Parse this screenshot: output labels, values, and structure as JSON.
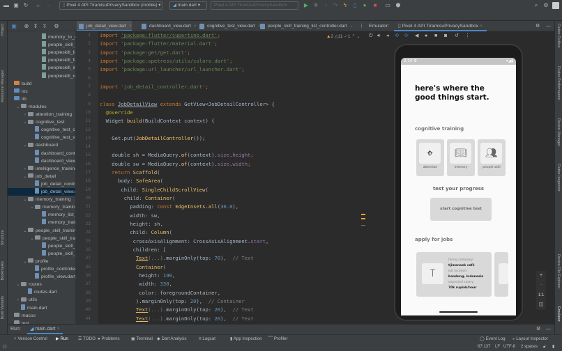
{
  "toolbar": {
    "device_selector": "Pixel 4 API TiramisuPrivacySandbox (mobile)",
    "run_config": "main.dart",
    "target_device": "Pixel 4 API TiramisuPrivacySandbox",
    "icons": [
      "folder-open-icon",
      "save-icon",
      "sync-icon",
      "back-icon",
      "forward-icon",
      "run-icon",
      "debug-icon",
      "profile-icon",
      "attach-icon",
      "hot-reload-icon",
      "device-icon",
      "apply-changes-icon",
      "stop-icon",
      "device-manager-icon",
      "sdk-manager-icon",
      "search-icon",
      "settings-icon",
      "avatar-icon"
    ]
  },
  "left_strip": [
    "Project",
    "Resource Manager",
    "Structure",
    "Bookmarks",
    "Build Variants"
  ],
  "project_tree": [
    {
      "name": "memory_to_do_list_t",
      "depth": 4,
      "type": "png"
    },
    {
      "name": "people_skill_icon.png",
      "depth": 4,
      "type": "png"
    },
    {
      "name": "peopleskill_face_fact",
      "depth": 4,
      "type": "png"
    },
    {
      "name": "peopleskill_face_to_f",
      "depth": 4,
      "type": "png"
    },
    {
      "name": "peopleskill_in_the_k",
      "depth": 4,
      "type": "png"
    },
    {
      "name": "peopleskill_recogniti",
      "depth": 4,
      "type": "png"
    },
    {
      "name": "build",
      "depth": 0,
      "type": "folder-orange"
    },
    {
      "name": "ios",
      "depth": 0,
      "type": "folder-blue"
    },
    {
      "name": "lib",
      "depth": 0,
      "type": "folder-blue"
    },
    {
      "name": "modules",
      "depth": 1,
      "type": "folder",
      "chev": "open"
    },
    {
      "name": "attention_training",
      "depth": 2,
      "type": "folder",
      "chev": "closed"
    },
    {
      "name": "cognitive_test",
      "depth": 2,
      "type": "folder",
      "chev": "open"
    },
    {
      "name": "cognitive_test_co",
      "depth": 3,
      "type": "dart"
    },
    {
      "name": "cognitive_test_vie",
      "depth": 3,
      "type": "dart"
    },
    {
      "name": "dashboard",
      "depth": 2,
      "type": "folder",
      "chev": "open"
    },
    {
      "name": "dashboard_contro",
      "depth": 3,
      "type": "dart"
    },
    {
      "name": "dashboard_view.d",
      "depth": 3,
      "type": "dart"
    },
    {
      "name": "intelligence_training",
      "depth": 2,
      "type": "folder",
      "chev": "closed"
    },
    {
      "name": "job_detail",
      "depth": 2,
      "type": "folder",
      "chev": "open"
    },
    {
      "name": "job_detail_control",
      "depth": 3,
      "type": "dart"
    },
    {
      "name": "job_detail_view.da",
      "depth": 3,
      "type": "dart",
      "selected": true
    },
    {
      "name": "memory_training",
      "depth": 2,
      "type": "folder",
      "chev": "open"
    },
    {
      "name": "memory_training_",
      "depth": 3,
      "type": "folder",
      "chev": "open"
    },
    {
      "name": "memory_list_v",
      "depth": 4,
      "type": "dart"
    },
    {
      "name": "memory_traini",
      "depth": 4,
      "type": "dart"
    },
    {
      "name": "people_skill_training",
      "depth": 2,
      "type": "folder",
      "chev": "open"
    },
    {
      "name": "people_skill_trai",
      "depth": 3,
      "type": "folder",
      "chev": "open"
    },
    {
      "name": "people_skill_tr",
      "depth": 4,
      "type": "dart"
    },
    {
      "name": "people_skill_tr",
      "depth": 4,
      "type": "dart"
    },
    {
      "name": "profile",
      "depth": 2,
      "type": "folder",
      "chev": "open"
    },
    {
      "name": "profile_controller.d",
      "depth": 3,
      "type": "dart"
    },
    {
      "name": "profile_view.dart",
      "depth": 3,
      "type": "dart"
    },
    {
      "name": "routes",
      "depth": 1,
      "type": "folder",
      "chev": "open"
    },
    {
      "name": "routes.dart",
      "depth": 2,
      "type": "dart"
    },
    {
      "name": "utils",
      "depth": 1,
      "type": "folder",
      "chev": "closed"
    },
    {
      "name": "main.dart",
      "depth": 1,
      "type": "dart"
    },
    {
      "name": "macos",
      "depth": 0,
      "type": "folder"
    },
    {
      "name": "test",
      "depth": 0,
      "type": "folder"
    }
  ],
  "editor_tabs": [
    {
      "label": "job_detail_view.dart",
      "active": true
    },
    {
      "label": "dashboard_view.dart"
    },
    {
      "label": "cognitive_test_view.dart"
    },
    {
      "label": "people_skill_training_list_controller.dart"
    }
  ],
  "inspections": {
    "warnings": "2",
    "weak_warnings": "11",
    "typos": "1"
  },
  "code": [
    {
      "n": "1",
      "t": [
        [
          "import",
          "kw"
        ],
        [
          " "
        ],
        [
          "'package:flutter/cupertino.dart'",
          "str u"
        ],
        [
          ";",
          "kw"
        ]
      ]
    },
    {
      "n": "2",
      "t": [
        [
          "import",
          "kw"
        ],
        [
          " "
        ],
        [
          "'package:flutter/material.dart'",
          "str"
        ],
        [
          ";",
          "kw"
        ]
      ]
    },
    {
      "n": "3",
      "t": [
        [
          "import",
          "kw"
        ],
        [
          " "
        ],
        [
          "'package:get/get.dart'",
          "str"
        ],
        [
          ";",
          "kw"
        ]
      ]
    },
    {
      "n": "4",
      "t": [
        [
          "import",
          "kw"
        ],
        [
          " "
        ],
        [
          "'package:spetress/utils/colors.dart'",
          "str"
        ],
        [
          ";",
          "kw"
        ]
      ]
    },
    {
      "n": "5",
      "t": [
        [
          "import",
          "kw"
        ],
        [
          " "
        ],
        [
          "'package:url_launcher/url_launcher.dart'",
          "str"
        ],
        [
          ";",
          "kw"
        ]
      ]
    },
    {
      "n": "6",
      "t": []
    },
    {
      "n": "7",
      "t": [
        [
          "import",
          "kw"
        ],
        [
          " "
        ],
        [
          "'job_detail_controller.dart'",
          "str"
        ],
        [
          ";",
          "kw"
        ]
      ]
    },
    {
      "n": "8",
      "t": []
    },
    {
      "n": "9",
      "t": [
        [
          "class",
          "kw"
        ],
        [
          " "
        ],
        [
          "JobDetailView",
          "u"
        ],
        [
          " "
        ],
        [
          "extends",
          "kw"
        ],
        [
          " GetView<JobDetailController> {"
        ]
      ]
    },
    {
      "n": "10",
      "t": [
        [
          "  "
        ],
        [
          "@override",
          "an"
        ]
      ]
    },
    {
      "n": "11",
      "t": [
        [
          "  Widget "
        ],
        [
          "build",
          "fn"
        ],
        [
          "(BuildContext context) {"
        ]
      ]
    },
    {
      "n": "12",
      "t": []
    },
    {
      "n": "13",
      "t": [
        [
          "    Get.put("
        ],
        [
          "JobDetailController",
          "fn"
        ],
        [
          "());"
        ]
      ]
    },
    {
      "n": "14",
      "t": []
    },
    {
      "n": "15",
      "t": [
        [
          "    double sh = MediaQuery."
        ],
        [
          "of",
          "fn"
        ],
        [
          "(context)."
        ],
        [
          "size",
          "prop"
        ],
        [
          "."
        ],
        [
          "height",
          "prop"
        ],
        [
          ";",
          "kw"
        ]
      ]
    },
    {
      "n": "16",
      "t": [
        [
          "    double sw = MediaQuery."
        ],
        [
          "of",
          "fn"
        ],
        [
          "(context)."
        ],
        [
          "size",
          "prop"
        ],
        [
          "."
        ],
        [
          "width",
          "prop"
        ],
        [
          ";",
          "kw"
        ]
      ]
    },
    {
      "n": "17",
      "t": [
        [
          "    "
        ],
        [
          "return",
          "kw"
        ],
        [
          " "
        ],
        [
          "Scaffold",
          "cls"
        ],
        [
          "("
        ]
      ]
    },
    {
      "n": "18",
      "t": [
        [
          "      body: "
        ],
        [
          "SafeArea",
          "cls"
        ],
        [
          "("
        ]
      ]
    },
    {
      "n": "19",
      "t": [
        [
          "       child: "
        ],
        [
          "SingleChildScrollView",
          "cls"
        ],
        [
          "("
        ]
      ]
    },
    {
      "n": "20",
      "t": [
        [
          "        child: "
        ],
        [
          "Container",
          "cls"
        ],
        [
          "("
        ]
      ]
    },
    {
      "n": "21",
      "t": [
        [
          "          padding: "
        ],
        [
          "const",
          "kw"
        ],
        [
          " "
        ],
        [
          "EdgeInsets.all",
          "cls"
        ],
        [
          "("
        ],
        [
          "30.0",
          "num"
        ],
        [
          "),"
        ]
      ]
    },
    {
      "n": "22",
      "t": [
        [
          "          width: sw,"
        ]
      ]
    },
    {
      "n": "23",
      "t": [
        [
          "          height: sh,"
        ]
      ]
    },
    {
      "n": "24",
      "t": [
        [
          "          child: "
        ],
        [
          "Column",
          "cls"
        ],
        [
          "("
        ]
      ]
    },
    {
      "n": "25",
      "t": [
        [
          "           crossAxisAlignment: CrossAxisAlignment."
        ],
        [
          "start",
          "prop"
        ],
        [
          ","
        ]
      ]
    },
    {
      "n": "26",
      "t": [
        [
          "           children: ["
        ]
      ]
    },
    {
      "n": "27",
      "t": [
        [
          "            "
        ],
        [
          "Text",
          "cls u"
        ],
        [
          "(...)",
          "cm"
        ],
        [
          ".marginOnly(top: "
        ],
        [
          "70",
          "num"
        ],
        [
          "),  "
        ],
        [
          "// Text",
          "cm"
        ]
      ]
    },
    {
      "n": "35",
      "t": [
        [
          "            "
        ],
        [
          "Container",
          "cls"
        ],
        [
          "("
        ]
      ]
    },
    {
      "n": "36",
      "t": [
        [
          "             height: "
        ],
        [
          "190",
          "num"
        ],
        [
          ","
        ]
      ]
    },
    {
      "n": "37",
      "t": [
        [
          "             width: "
        ],
        [
          "330",
          "num"
        ],
        [
          ","
        ]
      ]
    },
    {
      "n": "38",
      "t": [
        [
          "             color: foregroundContainer,"
        ]
      ]
    },
    {
      "n": "39",
      "t": [
        [
          "            ).marginOnly(top: "
        ],
        [
          "20",
          "num"
        ],
        [
          "),  "
        ],
        [
          "// Container",
          "cm"
        ]
      ]
    },
    {
      "n": "40",
      "t": [
        [
          "            "
        ],
        [
          "Text",
          "cls u"
        ],
        [
          "(...)",
          "cm"
        ],
        [
          ".marginOnly(top: "
        ],
        [
          "20",
          "num"
        ],
        [
          "),  "
        ],
        [
          "// Text",
          "cm"
        ]
      ]
    },
    {
      "n": "44",
      "t": [
        [
          "            "
        ],
        [
          "Text",
          "cls u"
        ],
        [
          "(...)",
          "cm"
        ],
        [
          ".marginOnly(top: "
        ],
        [
          "20",
          "num"
        ],
        [
          "),  "
        ],
        [
          "// Text",
          "cm"
        ]
      ]
    }
  ],
  "emulator": {
    "label": "Emulator:",
    "device_tab": "Pixel 4 API TiramisuPrivacySandbox",
    "zoom_controls": [
      "+",
      "−",
      "1:1"
    ],
    "app": {
      "status_time": "2:14",
      "headline": "here's where the good things start.",
      "cognitive_title": "cognitive training",
      "cognitive_cards": [
        "attention",
        "memory",
        "people skill"
      ],
      "progress_title": "test your progress",
      "start_button": "start cognitive test",
      "jobs_title": "apply for jobs",
      "job": {
        "company_label": "hiring company:",
        "company": "tjimanoek café",
        "location_label": "job location:",
        "location": "bandung, indonesia",
        "salary_label": "expected salary:",
        "salary": "70k rupiah/hour"
      }
    }
  },
  "right_strip": [
    "Flutter Outline",
    "Flutter Performance",
    "Device Manager",
    "Flutter Inspector",
    "Device File Explorer",
    "Emulator"
  ],
  "run_bar": {
    "label": "Run:",
    "config": "main.dart"
  },
  "tool_windows": [
    "Version Control",
    "Run",
    "TODO",
    "Problems",
    "Terminal",
    "Dart Analysis",
    "Logcat",
    "App Inspection",
    "Profiler"
  ],
  "tool_windows_right": [
    "Event Log",
    "Layout Inspector"
  ],
  "status": {
    "position": "67:137",
    "line_sep": "LF",
    "encoding": "UTF-8",
    "indent": "2 spaces"
  }
}
